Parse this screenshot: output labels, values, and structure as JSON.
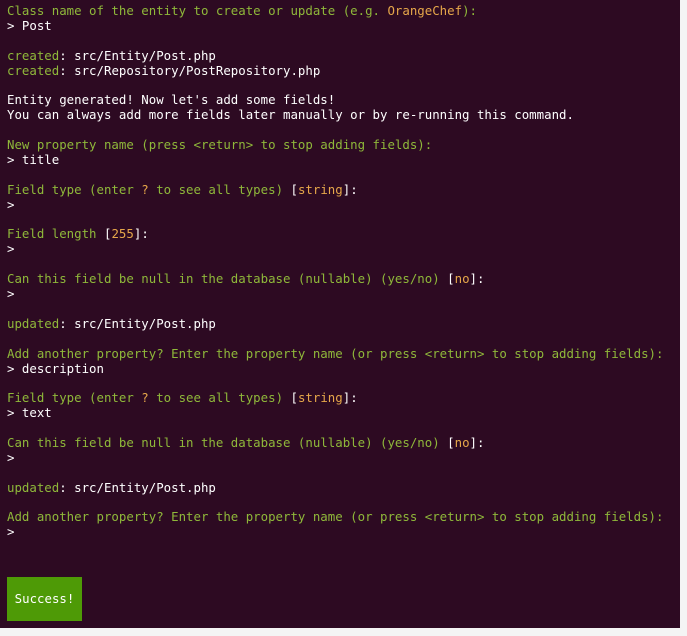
{
  "colors": {
    "background": "#2d0a22",
    "prompt_green": "#8fb83a",
    "default_yellow": "#e6a74a",
    "text_white": "#ffffff",
    "success_bg": "#4e9a06"
  },
  "q_class": {
    "text": "Class name of the entity to create or update (e.g. ",
    "example": "OrangeChef",
    "end": "):"
  },
  "a_class": "> Post",
  "created1": {
    "status": "created",
    "sep": ": ",
    "path": "src/Entity/Post.php"
  },
  "created2": {
    "status": "created",
    "sep": ": ",
    "path": "src/Repository/PostRepository.php"
  },
  "msg1": "Entity generated! Now let's add some fields!",
  "msg2": "You can always add more fields later manually or by re-running this command.",
  "q_prop1": "New property name (press <return> to stop adding fields):",
  "a_prop1": "> title",
  "q_type1": {
    "text": "Field type (enter ",
    "q": "?",
    "text2": " to see all types) ",
    "lb": "[",
    "default": "string",
    "rb": "]",
    "end": ":"
  },
  "a_type1": ">",
  "q_len": {
    "text": "Field length ",
    "lb": "[",
    "default": "255",
    "rb": "]",
    "end": ":"
  },
  "a_len": ">",
  "q_null1": {
    "text": "Can this field be null in the database (nullable) (yes/no) ",
    "lb": "[",
    "default": "no",
    "rb": "]",
    "end": ":"
  },
  "a_null1": ">",
  "updated1": {
    "status": "updated",
    "sep": ": ",
    "path": "src/Entity/Post.php"
  },
  "q_prop2": "Add another property? Enter the property name (or press <return> to stop adding fields):",
  "a_prop2": "> description",
  "q_type2": {
    "text": "Field type (enter ",
    "q": "?",
    "text2": " to see all types) ",
    "lb": "[",
    "default": "string",
    "rb": "]",
    "end": ":"
  },
  "a_type2": "> text",
  "q_null2": {
    "text": "Can this field be null in the database (nullable) (yes/no) ",
    "lb": "[",
    "default": "no",
    "rb": "]",
    "end": ":"
  },
  "a_null2": ">",
  "updated2": {
    "status": "updated",
    "sep": ": ",
    "path": "src/Entity/Post.php"
  },
  "q_prop3": "Add another property? Enter the property name (or press <return> to stop adding fields):",
  "a_prop3": ">",
  "success": "Success!"
}
